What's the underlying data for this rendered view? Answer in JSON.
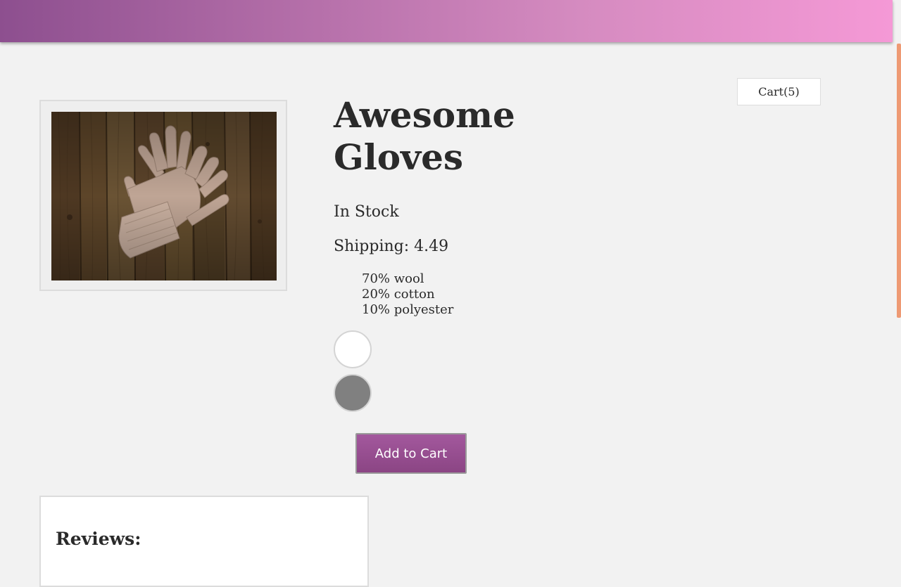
{
  "header": {
    "gradient_start": "#8d4f8f",
    "gradient_end": "#f599d6"
  },
  "cart": {
    "label": "Cart(5)"
  },
  "product": {
    "title": "Awesome Gloves",
    "image_alt": "gloves on wooden table",
    "stock_status": "In Stock",
    "shipping": "Shipping: 4.49",
    "materials": [
      "70% wool",
      "20% cotton",
      "10% polyester"
    ],
    "color_options": [
      {
        "name": "white",
        "color": "#ffffff"
      },
      {
        "name": "gray",
        "color": "#808080"
      }
    ],
    "add_to_cart_label": "Add to Cart"
  },
  "reviews": {
    "heading": "Reviews:"
  },
  "accent_colors": {
    "button": "#9a4f93",
    "scrollbar": "#ee9a74"
  }
}
